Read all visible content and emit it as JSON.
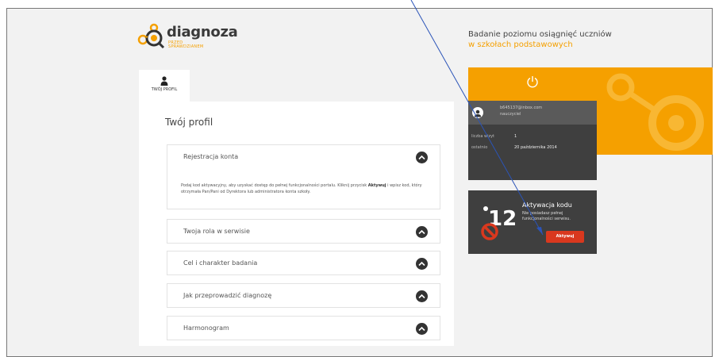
{
  "brand": {
    "name": "diagnoza",
    "subtitle_line1": "PRZED",
    "subtitle_line2": "SPRAWDZIANEM"
  },
  "header": {
    "tagline_line1": "Badanie poziomu osiągnięć uczniów",
    "tagline_line2": "w szkołach podstawowych"
  },
  "tabs": [
    {
      "label": "TWÓJ PROFIL",
      "icon": "person-icon",
      "active": true
    }
  ],
  "main": {
    "title": "Twój profil",
    "sections": [
      {
        "title": "Rejestracja konta",
        "expanded": true,
        "body_pre": "Podaj kod aktywacyjny, aby uzyskać dostęp do pełnej funkcjonalności portalu. Kliknij przycisk ",
        "body_bold": "Aktywuj",
        "body_post": " i wpisz kod, który otrzymała Pan/Pani od Dyrektora lub administratora konta szkoły."
      },
      {
        "title": "Twoja rola w serwisie",
        "expanded": false
      },
      {
        "title": "Cel i charakter badania",
        "expanded": false
      },
      {
        "title": "Jak przeprowadzić diagnozę",
        "expanded": false
      },
      {
        "title": "Harmonogram",
        "expanded": false
      }
    ]
  },
  "profile": {
    "email": "b645137@inbox.com",
    "role": "nauczyciel",
    "visits_label": "liczba wizyt",
    "visits_value": "1",
    "since_label": "ostatnio",
    "since_value": "20 października 2014"
  },
  "activation": {
    "title": "Aktywacja kodu",
    "desc": "Nie posiadasz pełnej funkcjonalności serwisu.",
    "button": "Aktywuj",
    "badge_text": "12"
  },
  "colors": {
    "accent": "#f5a000",
    "dark": "#3f3f3f",
    "button": "#d9381e",
    "annotation": "#2b54b8"
  }
}
